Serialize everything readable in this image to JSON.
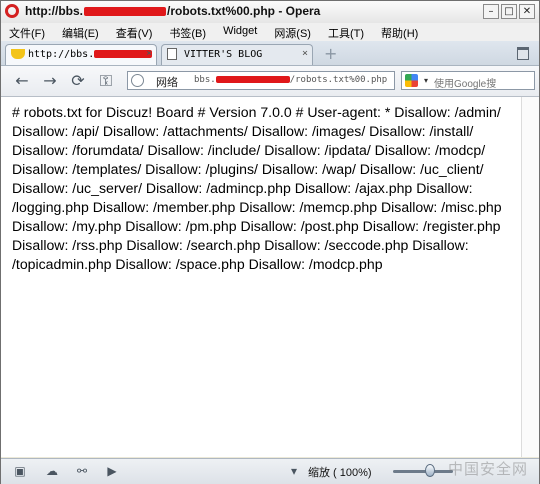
{
  "window": {
    "title_prefix": "http://bbs.",
    "title_suffix": "/robots.txt%00.php - Opera",
    "minimize_glyph": "–",
    "maximize_glyph": "□",
    "close_glyph": "✕"
  },
  "menubar": {
    "items": [
      "文件(F)",
      "编辑(E)",
      "查看(V)",
      "书签(B)",
      "Widget",
      "网源(S)",
      "工具(T)",
      "帮助(H)"
    ]
  },
  "tabs": [
    {
      "label": "http://bbs.",
      "close": "×",
      "active": true
    },
    {
      "label": "VITTER'S BLOG",
      "close": "×",
      "active": false
    }
  ],
  "newtab_glyph": "+",
  "nav": {
    "back": "←",
    "forward": "→",
    "reload": "⟳",
    "key": "⚿",
    "address_label": "网络",
    "url_prefix": "bbs.",
    "url_suffix": "/robots.txt%00.php",
    "search_placeholder": "使用Google搜"
  },
  "content": {
    "text": "# robots.txt for Discuz! Board # Version 7.0.0 # User-agent: * Disallow: /admin/ Disallow: /api/ Disallow: /attachments/ Disallow: /images/ Disallow: /install/ Disallow: /forumdata/ Disallow: /include/ Disallow: /ipdata/ Disallow: /modcp/ Disallow: /templates/ Disallow: /plugins/ Disallow: /wap/ Disallow: /uc_client/ Disallow: /uc_server/ Disallow: /admincp.php Disallow: /ajax.php Disallow: /logging.php Disallow: /member.php Disallow: /memcp.php Disallow: /misc.php Disallow: /my.php Disallow: /pm.php Disallow: /post.php Disallow: /register.php Disallow: /rss.php Disallow: /search.php Disallow: /seccode.php Disallow: /topicadmin.php Disallow: /space.php Disallow: /modcp.php"
  },
  "statusbar": {
    "zoom_label": "缩放 ( 100%)",
    "zoom_percent": 100,
    "watermark": "中国安全网"
  }
}
